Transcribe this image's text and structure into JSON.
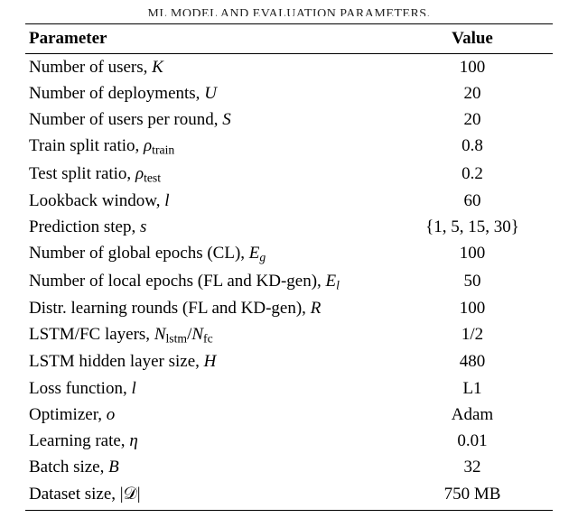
{
  "caption": "ML MODEL AND EVALUATION PARAMETERS.",
  "headers": {
    "param": "Parameter",
    "value": "Value"
  },
  "rows": [
    {
      "label_html": "Number of users, <span class='mi'>K</span>",
      "value": "100"
    },
    {
      "label_html": "Number of deployments, <span class='mi'>U</span>",
      "value": "20"
    },
    {
      "label_html": "Number of users per round, <span class='mi'>S</span>",
      "value": "20"
    },
    {
      "label_html": "Train split ratio, <span class='mi'>ρ</span><span class='sub'>train</span>",
      "value": "0.8"
    },
    {
      "label_html": "Test split ratio, <span class='mi'>ρ</span><span class='sub'>test</span>",
      "value": "0.2"
    },
    {
      "label_html": "Lookback window, <span class='mi'>l</span>",
      "value": "60"
    },
    {
      "label_html": "Prediction step, <span class='mi'>s</span>",
      "value": "{1, 5, 15, 30}"
    },
    {
      "label_html": "Number of global epochs (CL), <span class='mi'>E</span><span class='subi'>g</span>",
      "value": "100"
    },
    {
      "label_html": "Number of local epochs (FL and KD-gen), <span class='mi'>E</span><span class='subi'>l</span>",
      "value": "50"
    },
    {
      "label_html": "Distr. learning rounds (FL and KD-gen), <span class='mi'>R</span>",
      "value": "100"
    },
    {
      "label_html": "LSTM/FC layers, <span class='mi'>N</span><span class='sub'>lstm</span>/<span class='mi'>N</span><span class='sub'>fc</span>",
      "value": "1/2"
    },
    {
      "label_html": "LSTM hidden layer size, <span class='mi'>H</span>",
      "value": "480"
    },
    {
      "label_html": "Loss function, <span class='mi'>l</span>",
      "value": "L1"
    },
    {
      "label_html": "Optimizer, <span class='mi'>o</span>",
      "value": "Adam"
    },
    {
      "label_html": "Learning rate, <span class='mi'>η</span>",
      "value": "0.01"
    },
    {
      "label_html": "Batch size, <span class='mi'>B</span>",
      "value": "32"
    },
    {
      "label_html": "Dataset size, |<span style='font-family:serif'>𝒟</span>|",
      "value": "750 MB"
    }
  ],
  "chart_data": {
    "type": "table",
    "title": "ML MODEL AND EVALUATION PARAMETERS.",
    "columns": [
      "Parameter",
      "Value"
    ],
    "rows": [
      [
        "Number of users, K",
        "100"
      ],
      [
        "Number of deployments, U",
        "20"
      ],
      [
        "Number of users per round, S",
        "20"
      ],
      [
        "Train split ratio, ρ_train",
        "0.8"
      ],
      [
        "Test split ratio, ρ_test",
        "0.2"
      ],
      [
        "Lookback window, l",
        "60"
      ],
      [
        "Prediction step, s",
        "{1, 5, 15, 30}"
      ],
      [
        "Number of global epochs (CL), E_g",
        "100"
      ],
      [
        "Number of local epochs (FL and KD-gen), E_l",
        "50"
      ],
      [
        "Distr. learning rounds (FL and KD-gen), R",
        "100"
      ],
      [
        "LSTM/FC layers, N_lstm/N_fc",
        "1/2"
      ],
      [
        "LSTM hidden layer size, H",
        "480"
      ],
      [
        "Loss function, l",
        "L1"
      ],
      [
        "Optimizer, o",
        "Adam"
      ],
      [
        "Learning rate, η",
        "0.01"
      ],
      [
        "Batch size, B",
        "32"
      ],
      [
        "Dataset size, |D|",
        "750 MB"
      ]
    ]
  }
}
